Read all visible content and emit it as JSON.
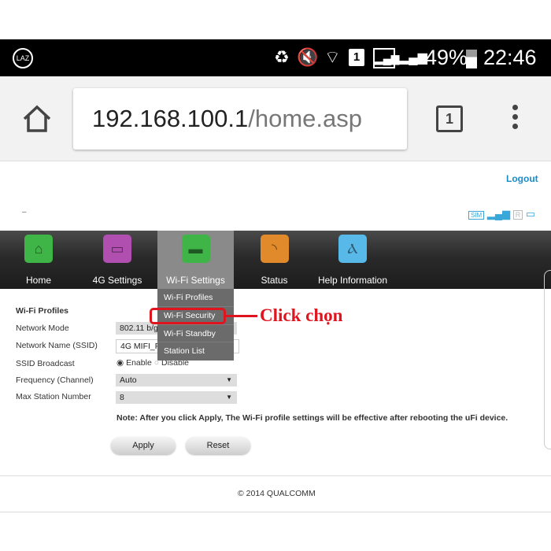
{
  "status_bar": {
    "app_icon": "laz-icon",
    "app_icon_text": "LAZ",
    "icons": [
      "battery-saver-icon",
      "mute-icon",
      "wifi-icon",
      "sim1-icon",
      "signal-icon",
      "signal-icon"
    ],
    "battery": "49%",
    "time": "22:46"
  },
  "browser": {
    "url_host": "192.168.100.1",
    "url_path": "/home.asp",
    "tab_count": "1"
  },
  "header": {
    "logout": "Logout",
    "dash": "–",
    "status_icons": [
      "sim-icon",
      "signal-icon",
      "roaming-icon",
      "wifi-device-icon"
    ]
  },
  "nav": {
    "items": [
      {
        "label": "Home",
        "color": "#3fb548"
      },
      {
        "label": "4G Settings",
        "color": "#b04fb0"
      },
      {
        "label": "Wi-Fi Settings",
        "color": "#3fb548"
      },
      {
        "label": "Status",
        "color": "#e08a2c"
      },
      {
        "label": "Help Information",
        "color": "#58b9e8"
      }
    ],
    "active": "Wi-Fi Settings"
  },
  "dropdown": {
    "items": [
      "Wi-Fi Profiles",
      "Wi-Fi Security",
      "Wi-Fi Standby",
      "Station List"
    ],
    "highlighted": "Wi-Fi Security"
  },
  "annotation": {
    "text": "Click chọn",
    "color": "#e0141e"
  },
  "form": {
    "title": "Wi-Fi Profiles",
    "labels": [
      "Network Mode",
      "Network Name (SSID)",
      "SSID Broadcast",
      "Frequency (Channel)",
      "Max Station Number"
    ],
    "network_mode": "802.11 b/g/n",
    "ssid": "4G MIFI_FD",
    "broadcast_enable": "Enable",
    "broadcast_disable": "Disable",
    "broadcast_selected": "Enable",
    "frequency": "Auto",
    "max_station": "8"
  },
  "note": "Note: After you click Apply, The Wi-Fi profile settings will be effective after rebooting the uFi device.",
  "buttons": {
    "apply": "Apply",
    "reset": "Reset"
  },
  "footer": "© 2014 QUALCOMM"
}
